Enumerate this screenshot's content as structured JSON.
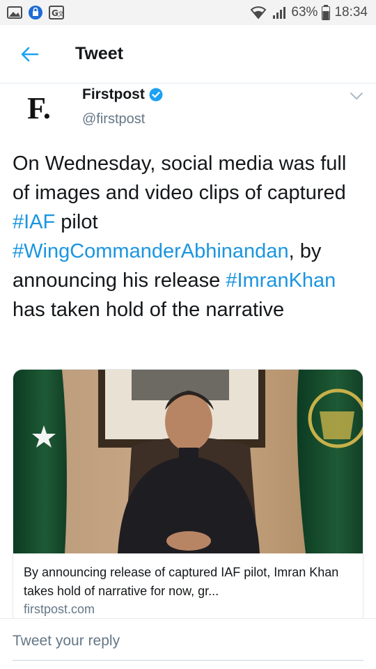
{
  "status_bar": {
    "battery": "63%",
    "time": "18:34",
    "notification_icons": [
      "image-icon",
      "vpn-shield-icon",
      "translate-icon"
    ],
    "system_icons": [
      "wifi-icon",
      "signal-icon",
      "battery-icon"
    ]
  },
  "app_bar": {
    "back_icon": "back-arrow-icon",
    "title": "Tweet"
  },
  "tweet": {
    "author_name": "Firstpost",
    "author_handle": "@firstpost",
    "avatar_letter": "F.",
    "verified": true,
    "text_parts": [
      {
        "text": "On Wednesday, social media was full of images and video clips of captured ",
        "hashtag": false
      },
      {
        "text": "#IAF",
        "hashtag": true
      },
      {
        "text": " pilot ",
        "hashtag": false
      },
      {
        "text": "#WingCommanderAbhinandan",
        "hashtag": true
      },
      {
        "text": ", by announcing his release ",
        "hashtag": false
      },
      {
        "text": "#ImranKhan",
        "hashtag": true
      },
      {
        "text": " has taken hold of the narrative",
        "hashtag": false
      }
    ],
    "card": {
      "title": "By announcing release of captured IAF pilot, Imran Khan takes hold of narrative for now, gr...",
      "domain": "firstpost.com"
    }
  },
  "reply": {
    "placeholder": "Tweet your reply"
  },
  "colors": {
    "hashtag": "#1b95e0",
    "text": "#14171a",
    "secondary": "#657786",
    "verified": "#1da1f2"
  }
}
